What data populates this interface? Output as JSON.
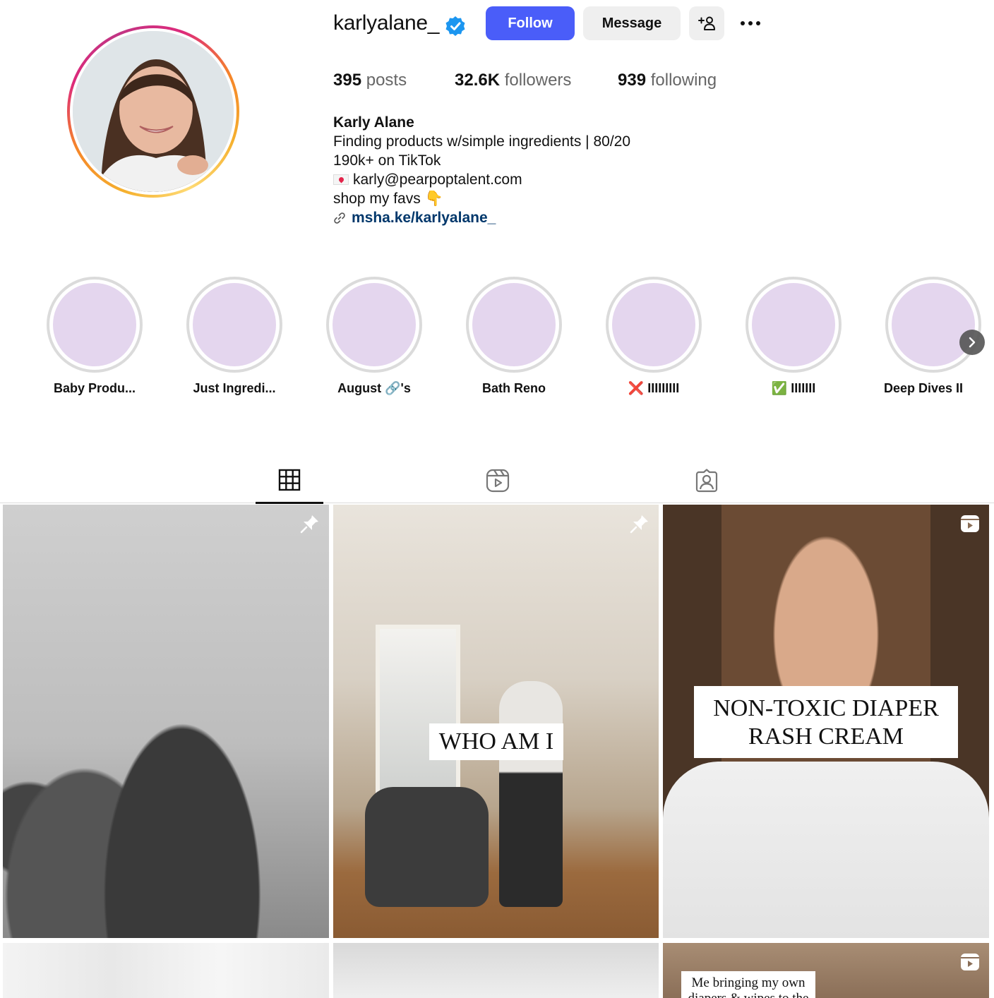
{
  "profile": {
    "username": "karlyalane_",
    "verified": true,
    "follow_label": "Follow",
    "message_label": "Message",
    "stats": {
      "posts_count": "395",
      "posts_label": "posts",
      "followers_count": "32.6K",
      "followers_label": "followers",
      "following_count": "939",
      "following_label": "following"
    },
    "bio": {
      "name": "Karly Alane",
      "line1": "Finding products w/simple ingredients | 80/20",
      "line2": "190k+ on TikTok",
      "email": "karly@pearpoptalent.com",
      "line4": "shop my favs 👇",
      "link": "msha.ke/karlyalane_"
    }
  },
  "highlights": [
    {
      "label": "Baby Produ..."
    },
    {
      "label": "Just Ingredi..."
    },
    {
      "label": "August 🔗's"
    },
    {
      "label": "Bath Reno"
    },
    {
      "label": "❌ IIIIIIIII"
    },
    {
      "label": "✅ IIIIIII"
    },
    {
      "label": "Deep Dives II"
    }
  ],
  "tabs": [
    {
      "name": "posts",
      "icon": "grid-icon",
      "active": true
    },
    {
      "name": "reels",
      "icon": "reels-icon",
      "active": false
    },
    {
      "name": "tagged",
      "icon": "tagged-icon",
      "active": false
    }
  ],
  "posts": [
    {
      "overlay": "",
      "badge": "pin-icon"
    },
    {
      "overlay": "WHO AM I",
      "badge": "pin-icon"
    },
    {
      "overlay": "NON-TOXIC DIAPER RASH CREAM",
      "badge": "reel-icon"
    },
    {
      "overlay": "",
      "badge": ""
    },
    {
      "overlay": "",
      "badge": ""
    },
    {
      "overlay": "Me bringing my own diapers & wipes to the",
      "badge": "reel-icon"
    }
  ],
  "colors": {
    "follow_button": "#4a5df9",
    "link": "#00376b",
    "highlight_fill": "#e4d6ee"
  }
}
